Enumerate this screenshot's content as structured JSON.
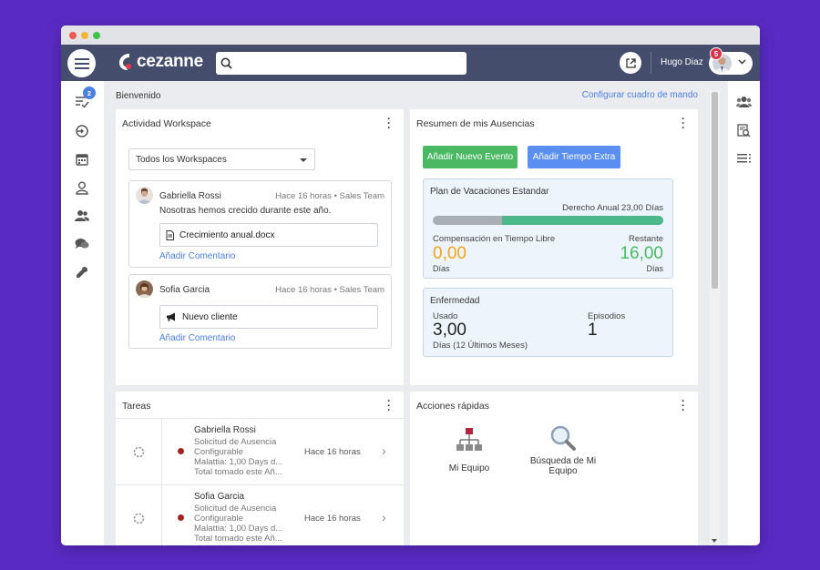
{
  "header": {
    "search_placeholder": "",
    "user_name": "Hugo Diaz",
    "notification_count": "5"
  },
  "sidebar": {
    "tasks_badge": "2"
  },
  "main": {
    "welcome": "Bienvenido",
    "config_link": "Configurar cuadro de mando"
  },
  "workspace": {
    "title": "Actividad Workspace",
    "filter_value": "Todos los Workspaces",
    "posts": [
      {
        "author": "Gabriella Rossi",
        "meta": "Hace 16 horas • Sales Team",
        "text": "Nosotras hemos crecido durante este año.",
        "attachment": "Crecimiento anual.docx",
        "comment_link": "Añadir Comentario"
      },
      {
        "author": "Sofia Garcia",
        "meta": "Hace 16 horas • Sales Team",
        "attachment": "Nuevo cliente",
        "comment_link": "Añadir Comentario"
      }
    ]
  },
  "absences": {
    "title": "Resumen de mis Ausencias",
    "btn_new_event": "Añadir Nuevo Evento",
    "btn_overtime": "Añadir Tiempo Extra",
    "vacation": {
      "title": "Plan de Vacaciones Estandar",
      "entitlement": "Derecho Anual 23,00 Días",
      "remaining_fraction": 0.7,
      "comp_label": "Compensación en Tiempo Libre",
      "comp_value": "0,00",
      "comp_unit": "Días",
      "remaining_label": "Restante",
      "remaining_value": "16,00",
      "remaining_unit": "Días"
    },
    "sickness": {
      "title": "Enfermedad",
      "used_label": "Usado",
      "used_value": "3,00",
      "used_unit": "Días (12 Últimos Meses)",
      "episodes_label": "Episodios",
      "episodes_value": "1"
    }
  },
  "tasks": {
    "title": "Tareas",
    "rows": [
      {
        "name": "Gabriella Rossi",
        "detail_1": "Solicitud de Ausencia",
        "detail_2": "Configurable",
        "detail_3": "Malattia: 1,00 Days d...",
        "detail_4": "Total tomado este Añ...",
        "time": "Hace 16 horas"
      },
      {
        "name": "Sofia Garcia",
        "detail_1": "Solicitud de Ausencia",
        "detail_2": "Configurable",
        "detail_3": "Malattia: 1,00 Days d...",
        "detail_4": "Total tomado este Añ...",
        "time": "Hace 16 horas"
      }
    ]
  },
  "quick_actions": {
    "title": "Acciones rápidas",
    "items": [
      {
        "label_1": "Mi Equipo",
        "label_2": ""
      },
      {
        "label_1": "Búsqueda de Mi",
        "label_2": "Equipo"
      }
    ]
  },
  "colors": {
    "topbar": "#444e6c",
    "accent_blue": "#4c7fe0",
    "green": "#4bb964",
    "orange": "#f0a41c",
    "background": "#5a2bc4"
  },
  "icons": [
    "hamburger-icon",
    "cezanne-logo-icon",
    "search-icon",
    "external-link-icon",
    "chevron-down-icon",
    "tasks-icon",
    "checkin-icon",
    "calendar-icon",
    "person-icon",
    "people-icon",
    "chat-icon",
    "wrench-icon",
    "team-icon",
    "report-search-icon",
    "list-icon",
    "document-icon",
    "megaphone-icon",
    "spinner-icon",
    "org-chart-icon",
    "magnifier-icon",
    "chevron-right-icon"
  ]
}
